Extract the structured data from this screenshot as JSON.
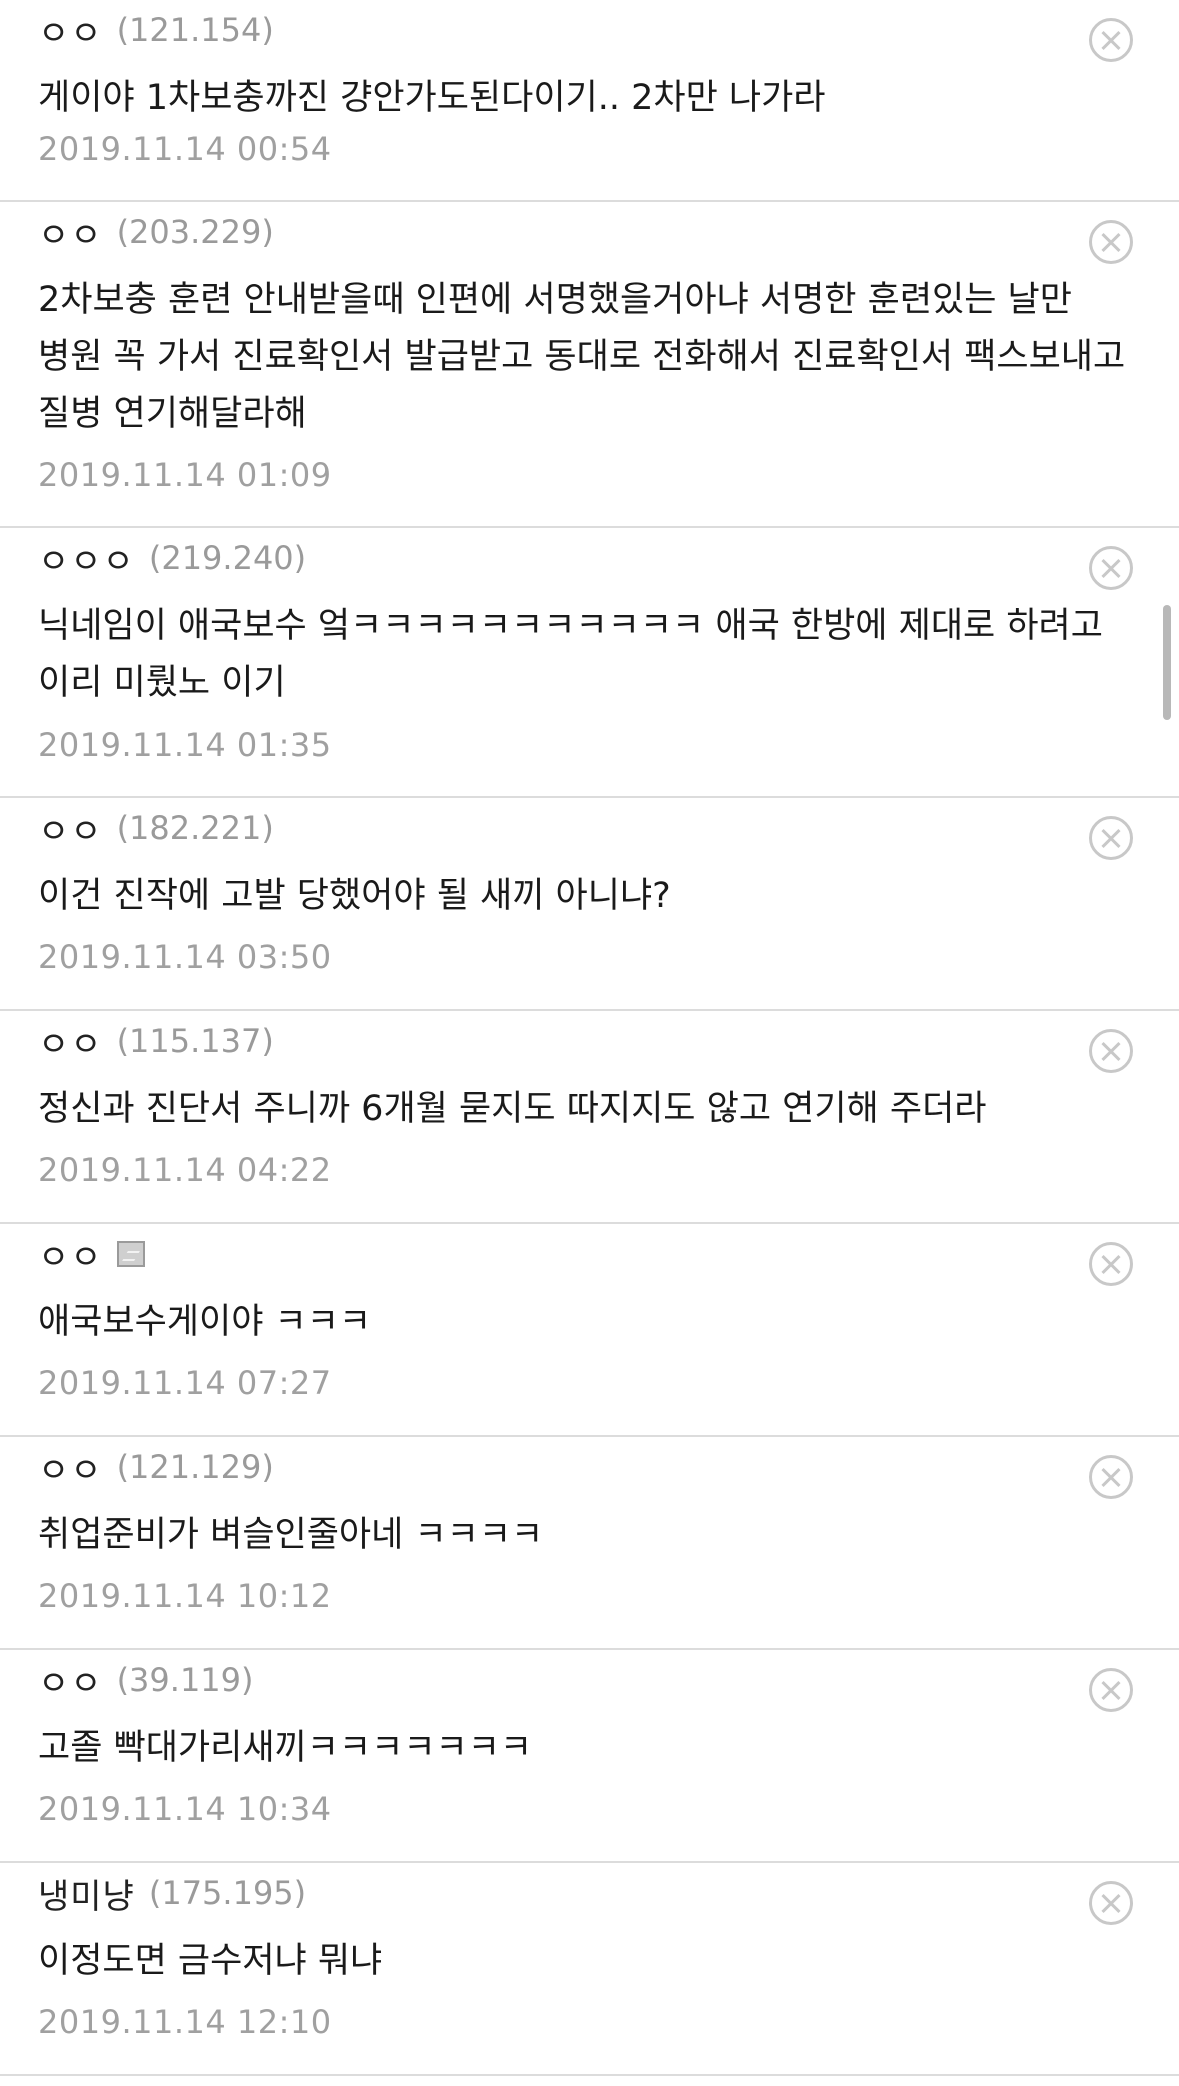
{
  "comments": [
    {
      "nickname": "ㅇㅇ",
      "ip": "(121.154)",
      "text": "게이야 1차보충까진 걍안가도된다이기.. 2차만 나가라",
      "date": "2019.11.14 00:54"
    },
    {
      "nickname": "ㅇㅇ",
      "ip": "(203.229)",
      "text": "2차보충 훈련 안내받을때 인편에 서명했을거아냐 서명한 훈련있는 날만 병원 꼭 가서 진료확인서 발급받고 동대로 전화해서 진료확인서 팩스보내고 질병 연기해달라해",
      "date": "2019.11.14 01:09"
    },
    {
      "nickname": "ㅇㅇㅇ",
      "ip": "(219.240)",
      "text": "닉네임이 애국보수 엌ㅋㅋㅋㅋㅋㅋㅋㅋㅋㅋㅋ 애국 한방에 제대로 하려고 이리 미뤘노 이기",
      "date": "2019.11.14 01:35"
    },
    {
      "nickname": "ㅇㅇ",
      "ip": "(182.221)",
      "text": "이건 진작에 고발 당했어야 될 새끼 아니냐?",
      "date": "2019.11.14 03:50"
    },
    {
      "nickname": "ㅇㅇ",
      "ip": "(115.137)",
      "text": "정신과 진단서 주니까 6개월 묻지도 따지지도 않고 연기해 주더라",
      "date": "2019.11.14 04:22"
    },
    {
      "nickname": "ㅇㅇ",
      "ip": "",
      "icon": "gallog-icon",
      "text": "애국보수게이야 ㅋㅋㅋ",
      "date": "2019.11.14 07:27"
    },
    {
      "nickname": "ㅇㅇ",
      "ip": "(121.129)",
      "text": "취업준비가 벼슬인줄아네 ㅋㅋㅋㅋ",
      "date": "2019.11.14 10:12"
    },
    {
      "nickname": "ㅇㅇ",
      "ip": "(39.119)",
      "text": "고졸 빡대가리새끼ㅋㅋㅋㅋㅋㅋㅋ",
      "date": "2019.11.14 10:34"
    },
    {
      "nickname": "냉미냥",
      "ip": "(175.195)",
      "text": "이정도면 금수저냐 뭐냐",
      "date": "2019.11.14 12:10"
    }
  ],
  "icons": {
    "delete": "close-circle-icon"
  },
  "colors": {
    "nickname": "#222222",
    "ip": "#9a9a9a",
    "body": "#1a1a1a",
    "date": "#a0a0a0",
    "divider": "#dcdcdc"
  }
}
